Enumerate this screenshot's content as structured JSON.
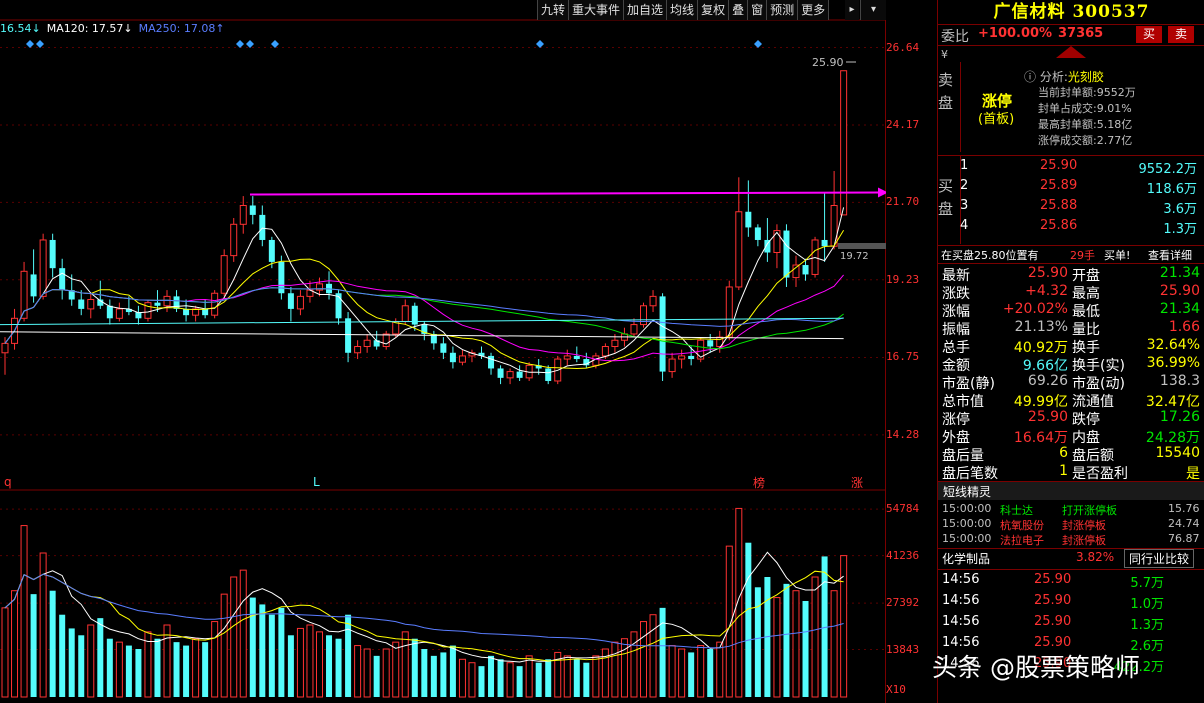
{
  "ma_legend": [
    {
      "text": "16.54↓",
      "color": "#54fcfc"
    },
    {
      "text": "MA120: 17.57↓",
      "color": "#ffffff"
    },
    {
      "text": "MA250: 17.08↑",
      "color": "#5a7dff"
    }
  ],
  "toolbar": [
    "九转",
    "重大事件",
    "加自选",
    "均线",
    "复权",
    "叠",
    "窗",
    "预测",
    "更多"
  ],
  "price_axis": [
    "26.64",
    "24.17",
    "21.70",
    "19.23",
    "16.75",
    "14.28"
  ],
  "vol_axis": [
    "54784",
    "41236",
    "27392",
    "13843",
    "X10"
  ],
  "chart_labels": {
    "high_label": "25.90",
    "mid_label": "19.72",
    "mark_q": "q",
    "mark_l": "L",
    "mark_bang": "榜",
    "mark_zhang": "涨"
  },
  "colors": {
    "up": "#ff3232",
    "down": "#54fcfc",
    "ma5": "#ffffff",
    "ma10": "#ffff00",
    "ma20": "#ff00ff",
    "ma60": "#00e600",
    "trendline": "#ff00ff",
    "panel_border": "#7a0000"
  },
  "chart_data": {
    "type": "candlestick",
    "candles": [
      {
        "o": 16.9,
        "h": 17.4,
        "l": 16.2,
        "c": 17.2
      },
      {
        "o": 17.2,
        "h": 18.3,
        "l": 17.0,
        "c": 18.0
      },
      {
        "o": 18.0,
        "h": 19.8,
        "l": 17.9,
        "c": 19.5
      },
      {
        "o": 19.4,
        "h": 20.2,
        "l": 18.5,
        "c": 18.7
      },
      {
        "o": 18.7,
        "h": 20.7,
        "l": 18.6,
        "c": 20.5
      },
      {
        "o": 20.5,
        "h": 20.7,
        "l": 19.3,
        "c": 19.6
      },
      {
        "o": 19.6,
        "h": 19.9,
        "l": 18.6,
        "c": 18.9
      },
      {
        "o": 18.9,
        "h": 19.4,
        "l": 18.4,
        "c": 18.6
      },
      {
        "o": 18.6,
        "h": 18.9,
        "l": 18.1,
        "c": 18.3
      },
      {
        "o": 18.3,
        "h": 18.8,
        "l": 18.0,
        "c": 18.6
      },
      {
        "o": 18.6,
        "h": 19.2,
        "l": 18.3,
        "c": 18.4
      },
      {
        "o": 18.4,
        "h": 18.6,
        "l": 17.8,
        "c": 18.0
      },
      {
        "o": 18.0,
        "h": 18.5,
        "l": 17.9,
        "c": 18.3
      },
      {
        "o": 18.3,
        "h": 18.7,
        "l": 18.1,
        "c": 18.2
      },
      {
        "o": 18.2,
        "h": 18.4,
        "l": 17.8,
        "c": 18.0
      },
      {
        "o": 18.0,
        "h": 18.6,
        "l": 17.9,
        "c": 18.5
      },
      {
        "o": 18.5,
        "h": 18.9,
        "l": 18.2,
        "c": 18.4
      },
      {
        "o": 18.4,
        "h": 18.9,
        "l": 18.2,
        "c": 18.7
      },
      {
        "o": 18.7,
        "h": 18.9,
        "l": 18.2,
        "c": 18.3
      },
      {
        "o": 18.3,
        "h": 18.6,
        "l": 17.9,
        "c": 18.1
      },
      {
        "o": 18.1,
        "h": 18.4,
        "l": 17.9,
        "c": 18.3
      },
      {
        "o": 18.3,
        "h": 18.6,
        "l": 18.0,
        "c": 18.1
      },
      {
        "o": 18.1,
        "h": 18.9,
        "l": 18.0,
        "c": 18.8
      },
      {
        "o": 18.8,
        "h": 20.2,
        "l": 18.7,
        "c": 20.0
      },
      {
        "o": 20.0,
        "h": 21.2,
        "l": 19.8,
        "c": 21.0
      },
      {
        "o": 21.0,
        "h": 21.9,
        "l": 20.7,
        "c": 21.6
      },
      {
        "o": 21.6,
        "h": 21.9,
        "l": 21.0,
        "c": 21.3
      },
      {
        "o": 21.3,
        "h": 21.6,
        "l": 20.3,
        "c": 20.5
      },
      {
        "o": 20.5,
        "h": 20.6,
        "l": 19.6,
        "c": 19.8
      },
      {
        "o": 19.8,
        "h": 20.0,
        "l": 18.6,
        "c": 18.8
      },
      {
        "o": 18.8,
        "h": 19.0,
        "l": 17.9,
        "c": 18.3
      },
      {
        "o": 18.3,
        "h": 18.9,
        "l": 18.1,
        "c": 18.7
      },
      {
        "o": 18.7,
        "h": 19.2,
        "l": 18.5,
        "c": 18.9
      },
      {
        "o": 18.9,
        "h": 19.3,
        "l": 18.7,
        "c": 19.1
      },
      {
        "o": 19.1,
        "h": 19.5,
        "l": 18.6,
        "c": 18.8
      },
      {
        "o": 18.8,
        "h": 18.9,
        "l": 17.8,
        "c": 18.0
      },
      {
        "o": 18.0,
        "h": 18.2,
        "l": 16.6,
        "c": 16.9
      },
      {
        "o": 16.9,
        "h": 17.3,
        "l": 16.7,
        "c": 17.1
      },
      {
        "o": 17.1,
        "h": 17.5,
        "l": 16.9,
        "c": 17.3
      },
      {
        "o": 17.3,
        "h": 17.6,
        "l": 17.0,
        "c": 17.1
      },
      {
        "o": 17.1,
        "h": 17.6,
        "l": 17.0,
        "c": 17.5
      },
      {
        "o": 17.5,
        "h": 18.0,
        "l": 17.4,
        "c": 17.9
      },
      {
        "o": 17.9,
        "h": 18.6,
        "l": 17.8,
        "c": 18.4
      },
      {
        "o": 18.4,
        "h": 18.5,
        "l": 17.6,
        "c": 17.8
      },
      {
        "o": 17.8,
        "h": 17.9,
        "l": 17.3,
        "c": 17.5
      },
      {
        "o": 17.5,
        "h": 17.6,
        "l": 17.0,
        "c": 17.2
      },
      {
        "o": 17.2,
        "h": 17.4,
        "l": 16.7,
        "c": 16.9
      },
      {
        "o": 16.9,
        "h": 17.1,
        "l": 16.4,
        "c": 16.6
      },
      {
        "o": 16.6,
        "h": 17.0,
        "l": 16.5,
        "c": 16.8
      },
      {
        "o": 16.8,
        "h": 17.0,
        "l": 16.6,
        "c": 16.9
      },
      {
        "o": 16.9,
        "h": 17.1,
        "l": 16.7,
        "c": 16.8
      },
      {
        "o": 16.8,
        "h": 16.9,
        "l": 16.2,
        "c": 16.4
      },
      {
        "o": 16.4,
        "h": 16.5,
        "l": 15.9,
        "c": 16.1
      },
      {
        "o": 16.1,
        "h": 16.4,
        "l": 15.9,
        "c": 16.3
      },
      {
        "o": 16.3,
        "h": 16.5,
        "l": 16.0,
        "c": 16.1
      },
      {
        "o": 16.1,
        "h": 16.6,
        "l": 16.0,
        "c": 16.5
      },
      {
        "o": 16.5,
        "h": 16.7,
        "l": 16.2,
        "c": 16.4
      },
      {
        "o": 16.4,
        "h": 16.5,
        "l": 15.9,
        "c": 16.0
      },
      {
        "o": 16.0,
        "h": 16.8,
        "l": 15.9,
        "c": 16.7
      },
      {
        "o": 16.7,
        "h": 17.0,
        "l": 16.5,
        "c": 16.8
      },
      {
        "o": 16.8,
        "h": 17.1,
        "l": 16.6,
        "c": 16.7
      },
      {
        "o": 16.7,
        "h": 16.9,
        "l": 16.4,
        "c": 16.5
      },
      {
        "o": 16.5,
        "h": 16.9,
        "l": 16.4,
        "c": 16.8
      },
      {
        "o": 16.8,
        "h": 17.2,
        "l": 16.7,
        "c": 17.1
      },
      {
        "o": 17.1,
        "h": 17.5,
        "l": 16.9,
        "c": 17.3
      },
      {
        "o": 17.3,
        "h": 17.7,
        "l": 17.1,
        "c": 17.5
      },
      {
        "o": 17.5,
        "h": 18.0,
        "l": 17.4,
        "c": 17.8
      },
      {
        "o": 17.8,
        "h": 18.5,
        "l": 17.7,
        "c": 18.4
      },
      {
        "o": 18.4,
        "h": 18.9,
        "l": 18.2,
        "c": 18.7
      },
      {
        "o": 18.7,
        "h": 18.8,
        "l": 16.0,
        "c": 16.3
      },
      {
        "o": 16.3,
        "h": 16.9,
        "l": 16.1,
        "c": 16.7
      },
      {
        "o": 16.7,
        "h": 17.0,
        "l": 16.4,
        "c": 16.8
      },
      {
        "o": 16.8,
        "h": 17.1,
        "l": 16.5,
        "c": 16.7
      },
      {
        "o": 16.7,
        "h": 17.4,
        "l": 16.6,
        "c": 17.3
      },
      {
        "o": 17.3,
        "h": 17.5,
        "l": 16.9,
        "c": 17.1
      },
      {
        "o": 17.1,
        "h": 17.6,
        "l": 16.9,
        "c": 17.4
      },
      {
        "o": 17.4,
        "h": 19.2,
        "l": 17.3,
        "c": 19.0
      },
      {
        "o": 19.0,
        "h": 22.5,
        "l": 18.9,
        "c": 21.4
      },
      {
        "o": 21.4,
        "h": 22.4,
        "l": 20.6,
        "c": 20.9
      },
      {
        "o": 20.9,
        "h": 21.0,
        "l": 20.3,
        "c": 20.5
      },
      {
        "o": 20.5,
        "h": 21.2,
        "l": 19.8,
        "c": 20.1
      },
      {
        "o": 20.1,
        "h": 21.0,
        "l": 19.6,
        "c": 20.8
      },
      {
        "o": 20.8,
        "h": 21.0,
        "l": 19.0,
        "c": 19.3
      },
      {
        "o": 19.3,
        "h": 20.0,
        "l": 19.0,
        "c": 19.7
      },
      {
        "o": 19.7,
        "h": 19.9,
        "l": 19.2,
        "c": 19.4
      },
      {
        "o": 19.4,
        "h": 20.6,
        "l": 19.3,
        "c": 20.5
      },
      {
        "o": 20.5,
        "h": 22.0,
        "l": 19.8,
        "c": 20.3
      },
      {
        "o": 20.3,
        "h": 22.7,
        "l": 20.2,
        "c": 21.6
      },
      {
        "o": 21.3,
        "h": 25.9,
        "l": 21.3,
        "c": 25.9
      }
    ],
    "volumes": [
      26000,
      31000,
      50000,
      30000,
      42000,
      31000,
      24000,
      20000,
      18000,
      21000,
      23000,
      17000,
      16000,
      15000,
      14000,
      19000,
      17000,
      21000,
      16000,
      15000,
      17000,
      16000,
      22000,
      30000,
      35000,
      37000,
      29000,
      27000,
      24000,
      26000,
      18000,
      20000,
      21000,
      19000,
      18000,
      17000,
      24000,
      15000,
      14000,
      12000,
      14000,
      16000,
      19000,
      17000,
      14000,
      12000,
      13000,
      15000,
      11000,
      10000,
      9000,
      12000,
      11000,
      10000,
      9000,
      12000,
      10000,
      11000,
      13000,
      12000,
      11000,
      10000,
      12000,
      14000,
      16000,
      17000,
      19000,
      22000,
      24000,
      26000,
      15000,
      14000,
      13000,
      15000,
      14000,
      16000,
      44000,
      55000,
      45000,
      32000,
      35000,
      29000,
      33000,
      31000,
      28000,
      35000,
      41000,
      31000,
      41236
    ],
    "ylim": [
      13.0,
      27.2
    ],
    "vol_max": 56000
  },
  "panel": {
    "title": "广信材料 300537",
    "weibi_label": "委比",
    "weibi_pct": "+100.00%",
    "weibi_num": "37365",
    "buy_btn": "买",
    "sell_btn": "卖",
    "sell_label": "卖盘",
    "yen": "¥",
    "limit_status": "涨停",
    "limit_sub": "(首板)",
    "analysis_label": "分析:",
    "analysis_topic": "光刻胶",
    "analysis_lines": [
      {
        "label": "当前封单额:",
        "value": "9552万"
      },
      {
        "label": "封单占成交:",
        "value": "9.01%"
      },
      {
        "label": "最高封单额:",
        "value": "5.18亿"
      },
      {
        "label": "涨停成交额:",
        "value": "2.77亿"
      }
    ],
    "buy_label": "买盘",
    "bids": [
      {
        "lvl": "1",
        "price": "25.90",
        "vol": "9552.2万"
      },
      {
        "lvl": "2",
        "price": "25.89",
        "vol": "118.6万"
      },
      {
        "lvl": "3",
        "price": "25.88",
        "vol": "3.6万"
      },
      {
        "lvl": "4",
        "price": "25.86",
        "vol": "1.3万"
      }
    ],
    "notice": {
      "prefix": "在买盘25.80位置有",
      "count": "29手",
      "suffix": "买单!",
      "detail": "查看详细"
    },
    "stats": [
      {
        "l1": "最新",
        "v1": "25.90",
        "c1": "red",
        "l2": "开盘",
        "v2": "21.34",
        "c2": "green"
      },
      {
        "l1": "涨跌",
        "v1": "+4.32",
        "c1": "red",
        "l2": "最高",
        "v2": "25.90",
        "c2": "red"
      },
      {
        "l1": "涨幅",
        "v1": "+20.02%",
        "c1": "red",
        "l2": "最低",
        "v2": "21.34",
        "c2": "green"
      },
      {
        "l1": "振幅",
        "v1": "21.13%",
        "c1": "gray",
        "l2": "量比",
        "v2": "1.66",
        "c2": "red"
      },
      {
        "l1": "总手",
        "v1": "40.92万",
        "c1": "yellow",
        "l2": "换手",
        "v2": "32.64%",
        "c2": "yellow"
      },
      {
        "l1": "金额",
        "v1": "9.66亿",
        "c1": "cyan",
        "l2": "换手(实)",
        "v2": "36.99%",
        "c2": "yellow"
      },
      {
        "l1": "市盈(静)",
        "v1": "69.26",
        "c1": "gray",
        "l2": "市盈(动)",
        "v2": "138.3",
        "c2": "gray"
      },
      {
        "l1": "总市值",
        "v1": "49.99亿",
        "c1": "yellow",
        "l2": "流通值",
        "v2": "32.47亿",
        "c2": "yellow"
      },
      {
        "l1": "涨停",
        "v1": "25.90",
        "c1": "red",
        "l2": "跌停",
        "v2": "17.26",
        "c2": "green"
      },
      {
        "l1": "外盘",
        "v1": "16.64万",
        "c1": "red",
        "l2": "内盘",
        "v2": "24.28万",
        "c2": "green"
      },
      {
        "l1": "盘后量",
        "v1": "6",
        "c1": "yellow",
        "l2": "盘后额",
        "v2": "15540",
        "c2": "yellow"
      },
      {
        "l1": "盘后笔数",
        "v1": "1",
        "c1": "yellow",
        "l2": "是否盈利",
        "v2": "是",
        "c2": "yellow"
      }
    ],
    "sprite_title": "短线精灵",
    "sprites": [
      {
        "time": "15:00:00",
        "name": "科士达",
        "event": "打开涨停板",
        "val": "15.76",
        "c": "green"
      },
      {
        "time": "15:00:00",
        "name": "杭氧股份",
        "event": "封涨停板",
        "val": "24.74",
        "c": "red"
      },
      {
        "time": "15:00:00",
        "name": "法拉电子",
        "event": "封涨停板",
        "val": "76.87",
        "c": "red"
      }
    ],
    "industry": {
      "name": "化学制品",
      "pct": "3.82%",
      "compare": "同行业比较"
    },
    "ticks": [
      {
        "time": "14:56",
        "price": "25.90",
        "vol": "5.7万"
      },
      {
        "time": "14:56",
        "price": "25.90",
        "vol": "1.0万"
      },
      {
        "time": "14:56",
        "price": "25.90",
        "vol": "1.3万"
      },
      {
        "time": "14:56",
        "price": "25.90",
        "vol": "2.6万"
      },
      {
        "time": "14:56",
        "price": "25.90",
        "vol": "422.2万"
      }
    ]
  },
  "watermark": "头条 @股票策略师"
}
